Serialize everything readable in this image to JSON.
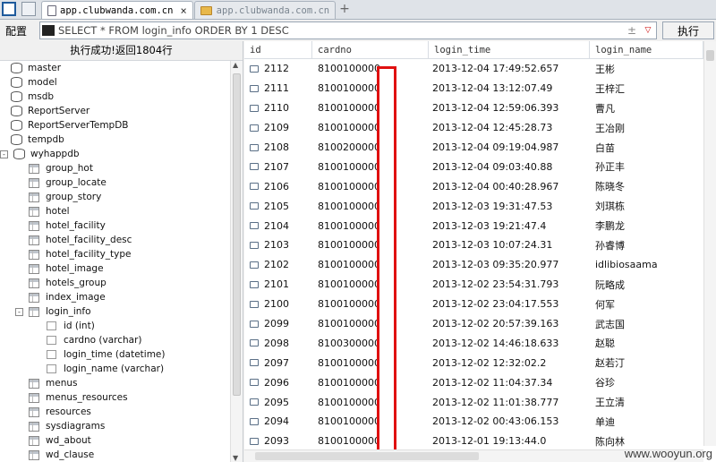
{
  "tabs": [
    {
      "label": "app.clubwanda.com.cn",
      "active": true
    },
    {
      "label": "app.clubwanda.com.cn",
      "active": false
    }
  ],
  "new_tab_label": "+",
  "toolbar": {
    "config_label": "配置",
    "sql_text": "SELECT * FROM login_info ORDER BY 1 DESC",
    "run_label": "执行"
  },
  "status_text": "执行成功!返回1804行",
  "tree": [
    {
      "label": "master",
      "type": "db",
      "level": 0
    },
    {
      "label": "model",
      "type": "db",
      "level": 0
    },
    {
      "label": "msdb",
      "type": "db",
      "level": 0
    },
    {
      "label": "ReportServer",
      "type": "db",
      "level": 0
    },
    {
      "label": "ReportServerTempDB",
      "type": "db",
      "level": 0
    },
    {
      "label": "tempdb",
      "type": "db",
      "level": 0
    },
    {
      "label": "wyhappdb",
      "type": "db",
      "level": 0,
      "expander": "-"
    },
    {
      "label": "group_hot",
      "type": "table",
      "level": 1
    },
    {
      "label": "group_locate",
      "type": "table",
      "level": 1
    },
    {
      "label": "group_story",
      "type": "table",
      "level": 1
    },
    {
      "label": "hotel",
      "type": "table",
      "level": 1
    },
    {
      "label": "hotel_facility",
      "type": "table",
      "level": 1
    },
    {
      "label": "hotel_facility_desc",
      "type": "table",
      "level": 1
    },
    {
      "label": "hotel_facility_type",
      "type": "table",
      "level": 1
    },
    {
      "label": "hotel_image",
      "type": "table",
      "level": 1
    },
    {
      "label": "hotels_group",
      "type": "table",
      "level": 1
    },
    {
      "label": "index_image",
      "type": "table",
      "level": 1
    },
    {
      "label": "login_info",
      "type": "table",
      "level": 1,
      "expander": "-"
    },
    {
      "label": "id (int)",
      "type": "column",
      "level": 2
    },
    {
      "label": "cardno (varchar)",
      "type": "column",
      "level": 2
    },
    {
      "label": "login_time (datetime)",
      "type": "column",
      "level": 2
    },
    {
      "label": "login_name (varchar)",
      "type": "column",
      "level": 2
    },
    {
      "label": "menus",
      "type": "table",
      "level": 1
    },
    {
      "label": "menus_resources",
      "type": "table",
      "level": 1
    },
    {
      "label": "resources",
      "type": "table",
      "level": 1
    },
    {
      "label": "sysdiagrams",
      "type": "table",
      "level": 1
    },
    {
      "label": "wd_about",
      "type": "table",
      "level": 1
    },
    {
      "label": "wd_clause",
      "type": "table",
      "level": 1
    }
  ],
  "grid": {
    "columns": [
      "id",
      "cardno",
      "login_time",
      "login_name"
    ],
    "rows": [
      [
        "2112",
        "8100100000",
        "2013-12-04 17:49:52.657",
        "王彬"
      ],
      [
        "2111",
        "8100100000",
        "2013-12-04 13:12:07.49",
        "王梓汇"
      ],
      [
        "2110",
        "8100100000",
        "2013-12-04 12:59:06.393",
        "曹凡"
      ],
      [
        "2109",
        "8100100000",
        "2013-12-04 12:45:28.73",
        "王冶刚"
      ],
      [
        "2108",
        "8100200000",
        "2013-12-04 09:19:04.987",
        "白苗"
      ],
      [
        "2107",
        "8100100000",
        "2013-12-04 09:03:40.88",
        "孙正丰"
      ],
      [
        "2106",
        "8100100000",
        "2013-12-04 00:40:28.967",
        "陈晓冬"
      ],
      [
        "2105",
        "8100100000",
        "2013-12-03 19:31:47.53",
        "刘琪栋"
      ],
      [
        "2104",
        "8100100000",
        "2013-12-03 19:21:47.4",
        "李鹏龙"
      ],
      [
        "2103",
        "8100100000",
        "2013-12-03 10:07:24.31",
        "孙睿博"
      ],
      [
        "2102",
        "8100100000",
        "2013-12-03 09:35:20.977",
        "idlibiosaama"
      ],
      [
        "2101",
        "8100100000",
        "2013-12-02 23:54:31.793",
        "阮略成"
      ],
      [
        "2100",
        "8100100000",
        "2013-12-02 23:04:17.553",
        "何军"
      ],
      [
        "2099",
        "8100100000",
        "2013-12-02 20:57:39.163",
        "武志国"
      ],
      [
        "2098",
        "8100300000",
        "2013-12-02 14:46:18.633",
        "赵聪"
      ],
      [
        "2097",
        "8100100000",
        "2013-12-02 12:32:02.2",
        "赵若汀"
      ],
      [
        "2096",
        "8100100000",
        "2013-12-02 11:04:37.34",
        "谷珍"
      ],
      [
        "2095",
        "8100100000",
        "2013-12-02 11:01:38.777",
        "王立清"
      ],
      [
        "2094",
        "8100100000",
        "2013-12-02 00:43:06.153",
        "单迪"
      ],
      [
        "2093",
        "8100100000",
        "2013-12-01 19:13:44.0",
        "陈向林"
      ]
    ]
  },
  "watermark": "www.wooyun.org",
  "colors": {
    "redaction": "#e01010",
    "tab_border": "#a9b2bd"
  }
}
